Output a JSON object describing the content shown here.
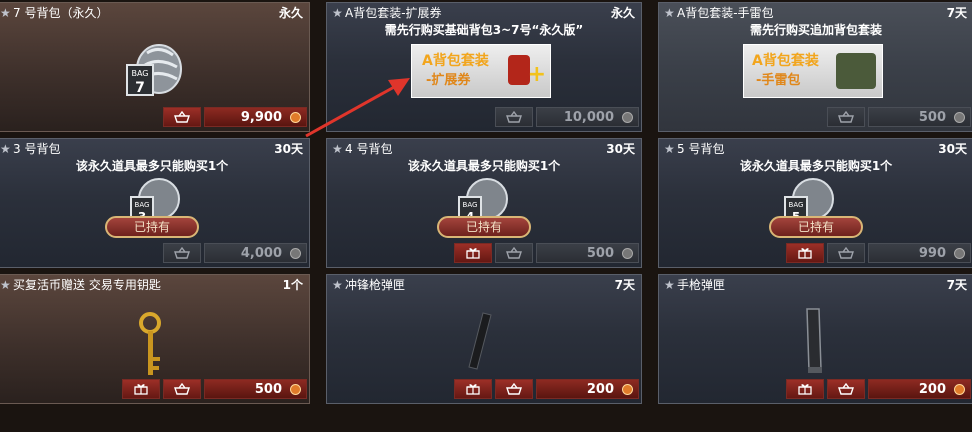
{
  "items": [
    {
      "name": "7 号背包（永久）",
      "duration": "永久",
      "note": "",
      "owned": "",
      "price": "9,900",
      "gift": false,
      "active": true
    },
    {
      "name": "A背包套装-扩展券",
      "duration": "永久",
      "note": "需先行购买基础背包3~7号“永久版”",
      "owned": "",
      "price": "10,000",
      "gift": false,
      "active": false
    },
    {
      "name": "A背包套装-手雷包",
      "duration": "7天",
      "note": "需先行购买追加背包套装",
      "owned": "",
      "price": "500",
      "gift": false,
      "active": false
    },
    {
      "name": "3 号背包",
      "duration": "30天",
      "note": "该永久道具最多只能购买1个",
      "owned": "已持有",
      "price": "4,000",
      "gift": false,
      "active": false
    },
    {
      "name": "4 号背包",
      "duration": "30天",
      "note": "该永久道具最多只能购买1个",
      "owned": "已持有",
      "price": "500",
      "gift": true,
      "active": false
    },
    {
      "name": "5 号背包",
      "duration": "30天",
      "note": "该永久道具最多只能购买1个",
      "owned": "已持有",
      "price": "990",
      "gift": true,
      "active": false
    },
    {
      "name": "买复活币赠送 交易专用钥匙",
      "duration": "1个",
      "note": "",
      "owned": "",
      "price": "500",
      "gift": true,
      "active": true
    },
    {
      "name": "冲锋枪弹匣",
      "duration": "7天",
      "note": "",
      "owned": "",
      "price": "200",
      "gift": true,
      "active": true
    },
    {
      "name": "手枪弹匣",
      "duration": "7天",
      "note": "",
      "owned": "",
      "price": "200",
      "gift": true,
      "active": true
    }
  ],
  "banners": {
    "expand": {
      "line1": "A背包套装",
      "line2": "-扩展券"
    },
    "grenade": {
      "line1": "A背包套装",
      "line2": "-手雷包"
    }
  },
  "bag_labels": {
    "tag": "BAG",
    "n7": "7",
    "n3": "3",
    "n4": "4",
    "n5": "5"
  },
  "icons": {
    "star": "star-icon",
    "gift": "gift-icon",
    "cart": "cart-icon",
    "coin": "coin-icon"
  },
  "colors": {
    "buy_red": "#8d2a22",
    "disabled": "#3b3f47",
    "owned_border": "#d9b676",
    "arrow": "#e0352b"
  }
}
